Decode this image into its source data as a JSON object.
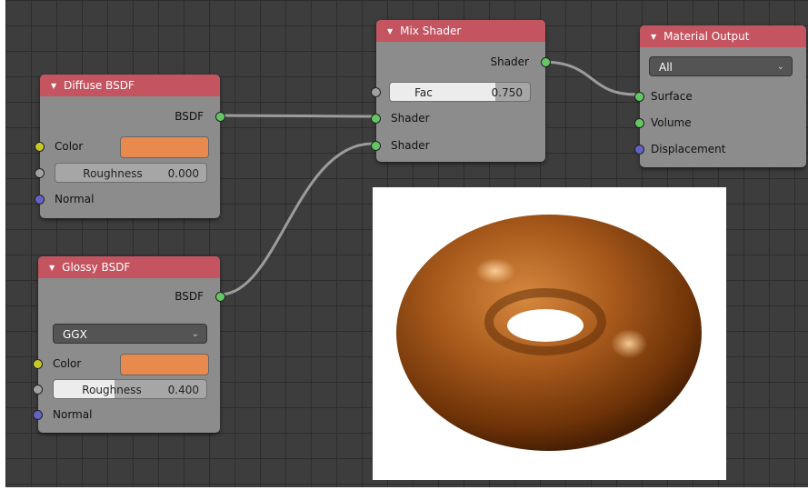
{
  "nodes": {
    "diffuse": {
      "title": "Diffuse BSDF",
      "output_label": "BSDF",
      "color_label": "Color",
      "color_value": "#e8894e",
      "roughness_label": "Roughness",
      "roughness_value": "0.000",
      "normal_label": "Normal"
    },
    "glossy": {
      "title": "Glossy BSDF",
      "output_label": "BSDF",
      "distribution": "GGX",
      "color_label": "Color",
      "color_value": "#e8894e",
      "roughness_label": "Roughness",
      "roughness_value": "0.400",
      "roughness_fraction": 0.4,
      "normal_label": "Normal"
    },
    "mix": {
      "title": "Mix Shader",
      "output_label": "Shader",
      "fac_label": "Fac",
      "fac_value": "0.750",
      "fac_fraction": 0.75,
      "shader1_label": "Shader",
      "shader2_label": "Shader"
    },
    "output": {
      "title": "Material Output",
      "target": "All",
      "surface_label": "Surface",
      "volume_label": "Volume",
      "displacement_label": "Displacement"
    }
  },
  "colors": {
    "header_red": "#c45460",
    "socket_shader": "#63c763",
    "socket_color": "#c7c729",
    "socket_value": "#a1a1a1",
    "socket_vector": "#6363c7",
    "swatch": "#e8894e"
  },
  "preview": {
    "subject": "torus"
  }
}
